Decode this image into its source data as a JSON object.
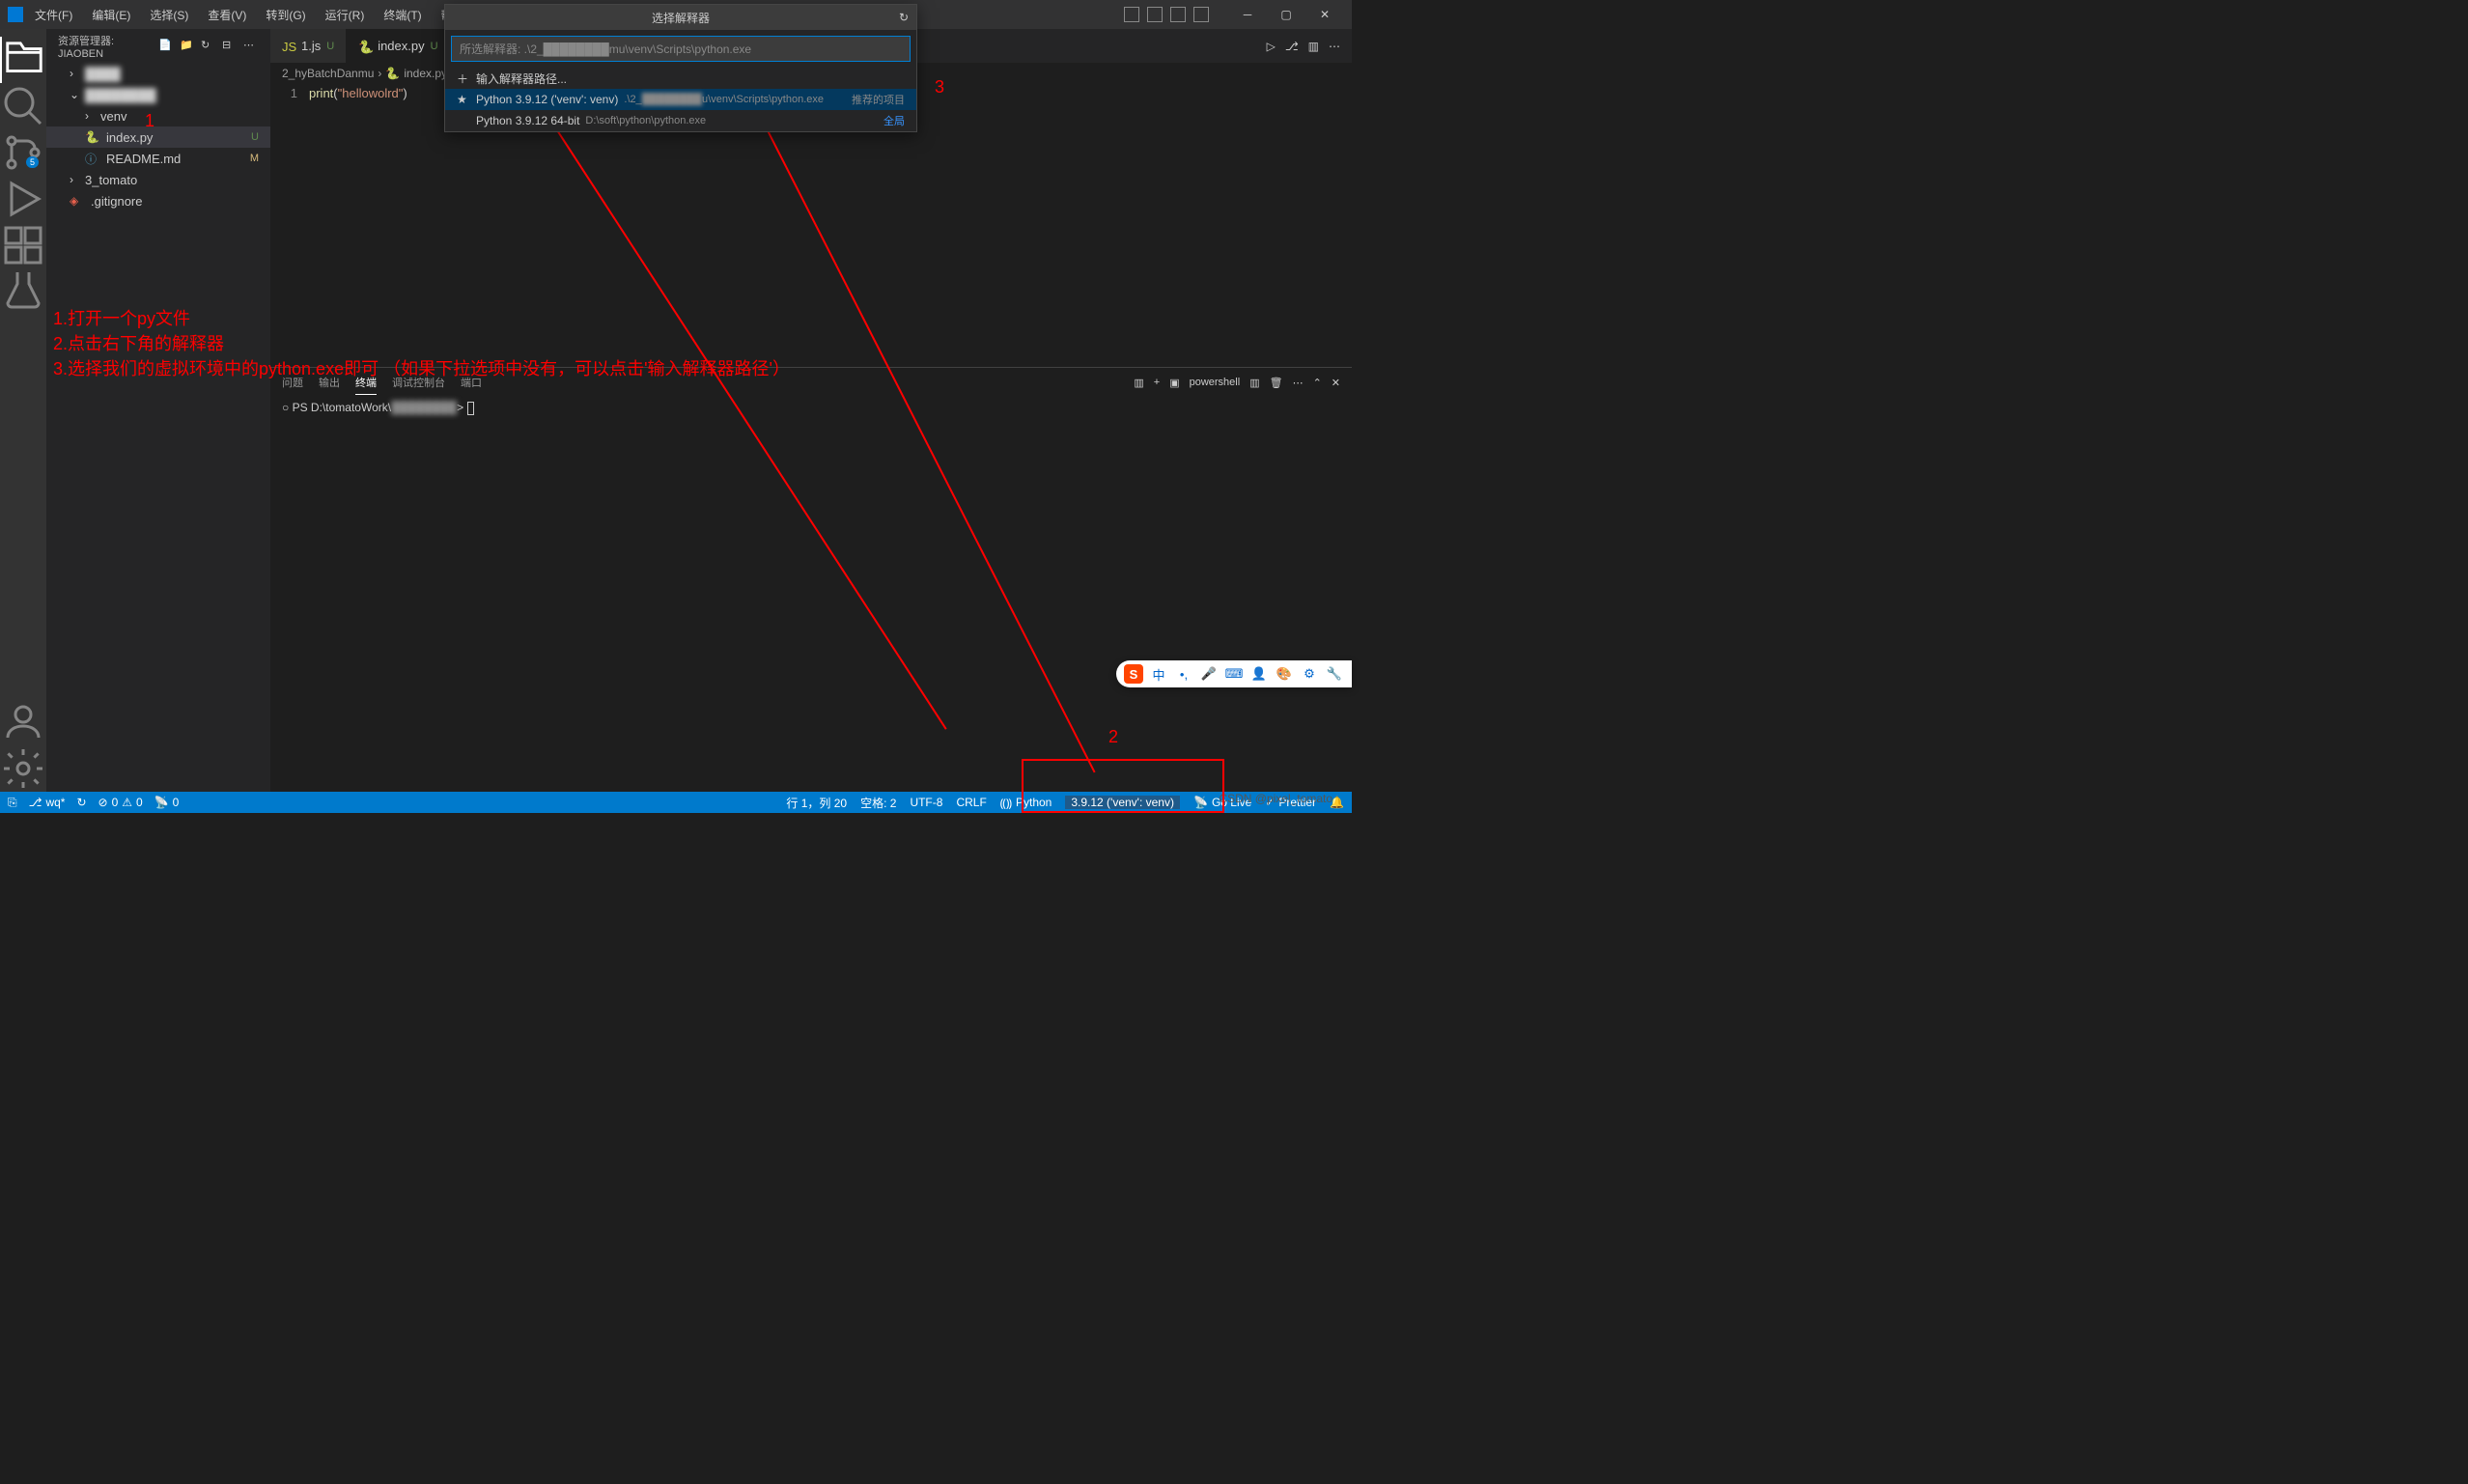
{
  "menu": {
    "file": "文件(F)",
    "edit": "编辑(E)",
    "select": "选择(S)",
    "view": "查看(V)",
    "go": "转到(G)",
    "run": "运行(R)",
    "terminal": "终端(T)",
    "help": "帮助(H)"
  },
  "sidebar": {
    "title": "资源管理器: JIAOBEN",
    "items": [
      {
        "label": "████",
        "type": "folder",
        "collapsed": true,
        "indent": 1,
        "blur": true
      },
      {
        "label": "████████",
        "type": "folder",
        "collapsed": false,
        "indent": 1,
        "blur": true
      },
      {
        "label": "venv",
        "type": "folder",
        "collapsed": true,
        "indent": 2
      },
      {
        "label": "index.py",
        "type": "file",
        "icon": "python",
        "indent": 2,
        "status": "U",
        "selected": true
      },
      {
        "label": "README.md",
        "type": "file",
        "icon": "info",
        "indent": 2,
        "status": "M"
      },
      {
        "label": "3_tomato",
        "type": "folder",
        "collapsed": true,
        "indent": 1
      },
      {
        "label": ".gitignore",
        "type": "file",
        "icon": "git",
        "indent": 1
      }
    ]
  },
  "tabs": [
    {
      "icon": "js",
      "label": "1.js",
      "status": "U",
      "active": false
    },
    {
      "icon": "python",
      "label": "index.py",
      "status": "U",
      "active": true
    }
  ],
  "breadcrumb": {
    "folder": "2_hyBatchDanmu",
    "file": "index.py"
  },
  "code": {
    "line1_num": "1",
    "line1_func": "print",
    "line1_str": "\"hellowolrd\""
  },
  "quickpick": {
    "title": "选择解释器",
    "placeholder": "所选解释器: .\\2_████████mu\\venv\\Scripts\\python.exe",
    "enter_path": "输入解释器路径...",
    "item1_label": "Python 3.9.12 ('venv': venv)",
    "item1_path_prefix": ".\\2_",
    "item1_path_blur": "████████",
    "item1_path_suffix": "u\\venv\\Scripts\\python.exe",
    "item1_tag": "推荐的项目",
    "item2_label": "Python 3.9.12 64-bit",
    "item2_path": "D:\\soft\\python\\python.exe",
    "item2_tag": "全局"
  },
  "panel": {
    "tabs": {
      "problems": "问题",
      "output": "输出",
      "terminal": "终端",
      "debug": "调试控制台",
      "ports": "端口"
    },
    "shell": "powershell",
    "prompt_prefix": "PS D:\\tomatoWork\\",
    "prompt_blur": "████████",
    "prompt_suffix": ">"
  },
  "status": {
    "branch": "wq*",
    "sync": "↻",
    "errors": "0",
    "warnings": "0",
    "ports": "0",
    "cursor": "行 1，列 20",
    "spaces": "空格: 2",
    "encoding": "UTF-8",
    "eol": "CRLF",
    "language": "Python",
    "interpreter": "3.9.12 ('venv': venv)",
    "golive": "Go Live",
    "prettier": "Prettier"
  },
  "annotations": {
    "num1": "1",
    "num2": "2",
    "num3": "3",
    "step1": "1.打开一个py文件",
    "step2": "2.点击右下角的解释器",
    "step3": "3.选择我们的虚拟环境中的python.exe即可  （如果下拉选项中没有，可以点击'输入解释器路径'）"
  },
  "watermark": "CSDN @pixel_tomato",
  "ime": {
    "lang": "中"
  }
}
